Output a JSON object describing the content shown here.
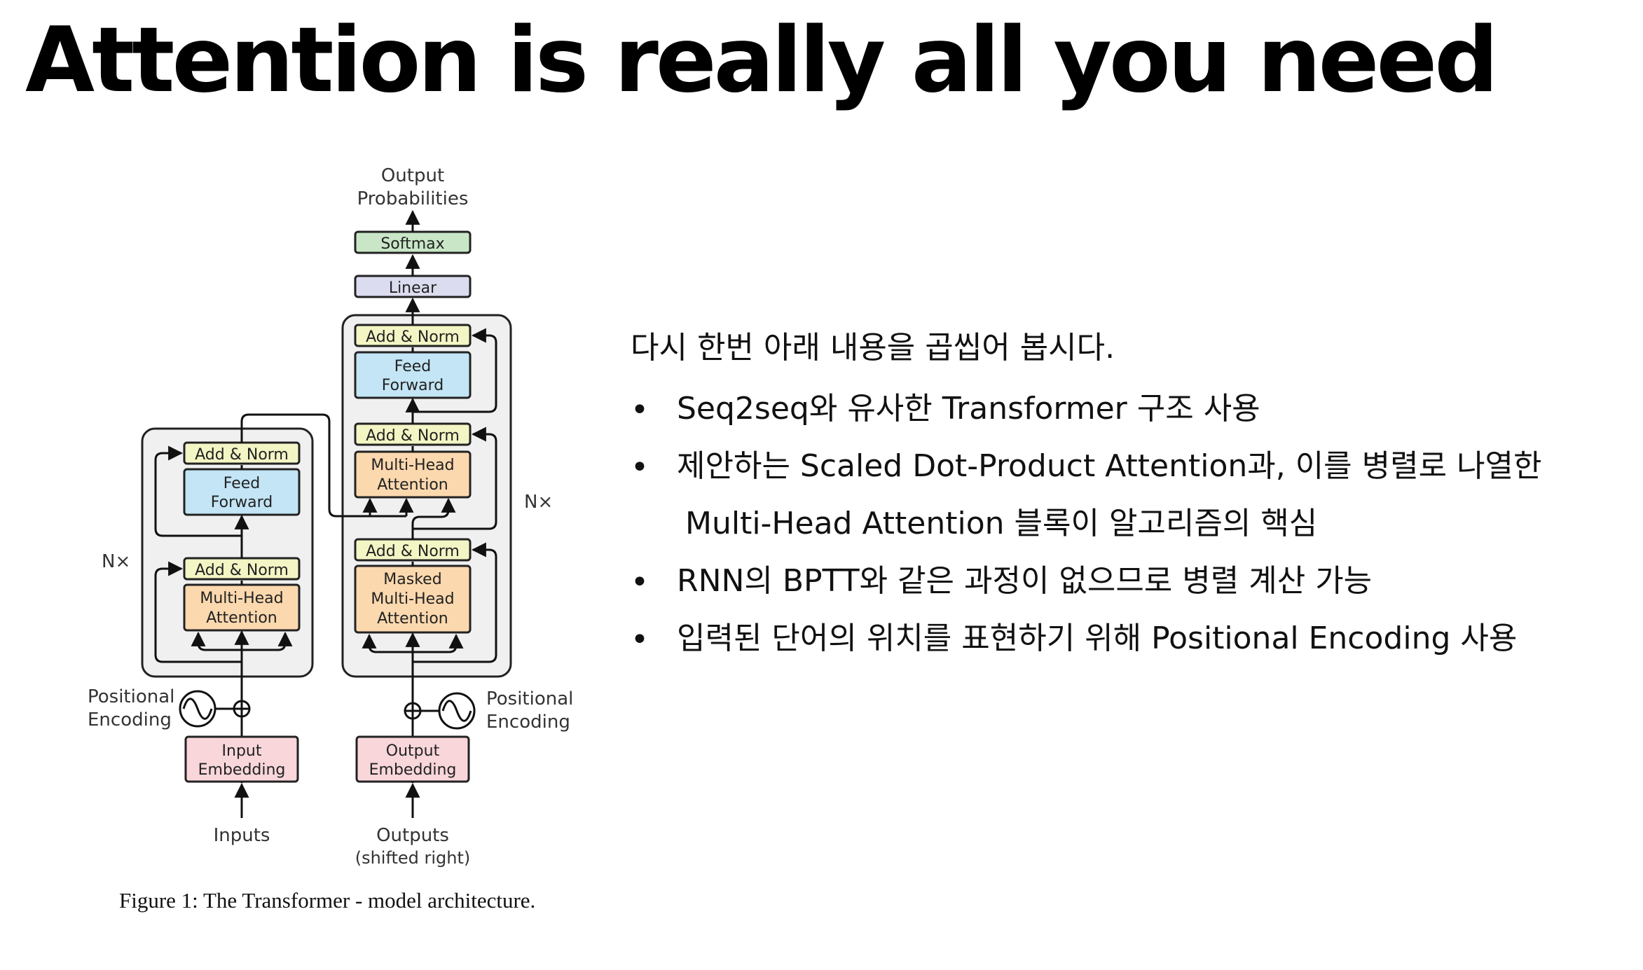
{
  "slide": {
    "title": "Attention is really all you need",
    "intro": "다시 한번 아래 내용을 곱씹어 봅시다.",
    "bullet_marker": "•",
    "bullets": [
      {
        "line1": "Seq2seq와 유사한 Transformer 구조 사용",
        "line2": ""
      },
      {
        "line1": "제안하는 Scaled Dot-Product Attention과, 이를 병렬로 나열한",
        "line2": "Multi-Head Attention 블록이 알고리즘의 핵심"
      },
      {
        "line1": "RNN의 BPTT와 같은 과정이 없으므로 병렬 계산 가능",
        "line2": ""
      },
      {
        "line1": "입력된 단어의 위치를 표현하기 위해 Positional Encoding 사용",
        "line2": ""
      }
    ]
  },
  "figure": {
    "caption": "Figure 1: The Transformer - model architecture.",
    "output_label": [
      "Output",
      "Probabilities"
    ],
    "softmax": "Softmax",
    "linear": "Linear",
    "add_norm": "Add & Norm",
    "feed_forward": [
      "Feed",
      "Forward"
    ],
    "multi_head": [
      "Multi-Head",
      "Attention"
    ],
    "masked_multi_head": [
      "Masked",
      "Multi-Head",
      "Attention"
    ],
    "nx": "N×",
    "positional_encoding": [
      "Positional",
      "Encoding"
    ],
    "input_embedding": [
      "Input",
      "Embedding"
    ],
    "output_embedding": [
      "Output",
      "Embedding"
    ],
    "inputs": "Inputs",
    "outputs": [
      "Outputs",
      "(shifted right)"
    ]
  },
  "colors": {
    "add_norm": "#f3f5c4",
    "feed_forward": "#c3e5f5",
    "attention": "#fbd8ae",
    "embedding": "#f8d6da",
    "linear": "#dcdcf0",
    "softmax": "#c9e7c7",
    "stack_bg": "#f0f0f0"
  }
}
